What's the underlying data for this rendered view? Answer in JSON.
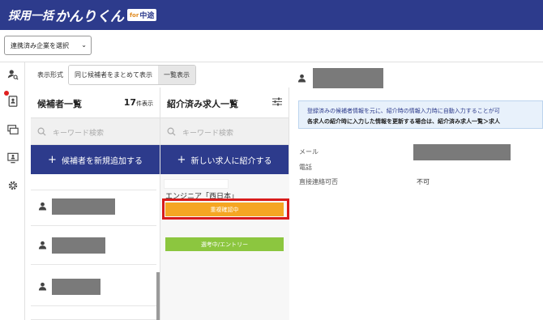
{
  "header": {
    "logo_main": "採用一括",
    "logo_brand": "かんりくん",
    "logo_badge_for": "for",
    "logo_badge_chu": "中途"
  },
  "topbar": {
    "company_select": "連携済み企業を選択"
  },
  "display": {
    "label": "表示形式",
    "options": [
      "同じ候補者をまとめて表示",
      "一覧表示"
    ],
    "selected": "同じ候補者をまとめて表示"
  },
  "candidates": {
    "title": "候補者一覧",
    "count": "17",
    "count_unit": "件表示",
    "search_placeholder": "キーワード検索",
    "add_button": "候補者を新規追加する"
  },
  "jobs": {
    "title": "紹介済み求人一覧",
    "search_placeholder": "キーワード検索",
    "add_button": "新しい求人に紹介する",
    "job_title": "エンジニア「西日本」",
    "status_duplicate": "重複確認中",
    "status_selection": "選考中/エントリー"
  },
  "detail": {
    "notice_line1": "登録済みの候補者情報を元に、紹介時の情報入力時に自動入力することが可",
    "notice_line2": "各求人の紹介時に入力した情報を更新する場合は、紹介済み求人一覧＞求人",
    "fields": [
      {
        "label": "メール",
        "value": ""
      },
      {
        "label": "電話",
        "value": ""
      },
      {
        "label": "直接連絡可否",
        "value": "不可"
      }
    ]
  },
  "colors": {
    "brand": "#2d3b8c",
    "duplicate_status": "#f5a623",
    "selection_status": "#8cc63f",
    "highlight": "#d81b1b"
  }
}
